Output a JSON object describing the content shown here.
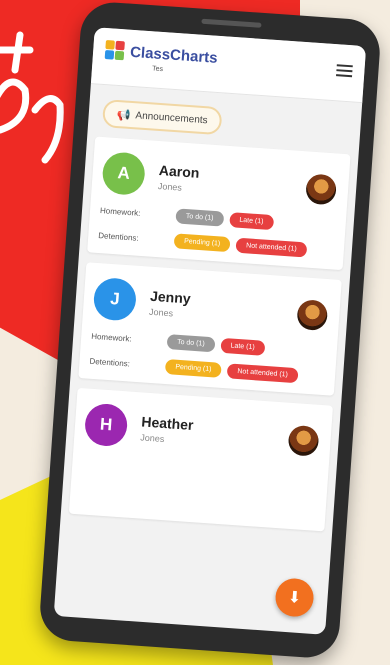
{
  "app": {
    "name": "ClassCharts",
    "sub": "Tes"
  },
  "announcement": {
    "label": "Announcements"
  },
  "labels": {
    "homework": "Homework:",
    "detentions": "Detentions:"
  },
  "students": [
    {
      "initial": "A",
      "first": "Aaron",
      "last": "Jones",
      "color": "#78c04a",
      "homework": [
        "To do (1)",
        "Late (1)"
      ],
      "detentions": [
        "Pending (1)",
        "Not attended (1)"
      ]
    },
    {
      "initial": "J",
      "first": "Jenny",
      "last": "Jones",
      "color": "#2a93e8",
      "homework": [
        "To do (1)",
        "Late (1)"
      ],
      "detentions": [
        "Pending (1)",
        "Not attended (1)"
      ]
    },
    {
      "initial": "H",
      "first": "Heather",
      "last": "Jones",
      "color": "#9b27b0",
      "homework": [],
      "detentions": []
    }
  ],
  "colors": {
    "red": "#ee2a24",
    "yellow": "#f5e51b",
    "fab": "#f2701f"
  },
  "icons": {
    "menu": "hamburger-icon",
    "announce": "megaphone-icon",
    "fab": "download-icon"
  }
}
